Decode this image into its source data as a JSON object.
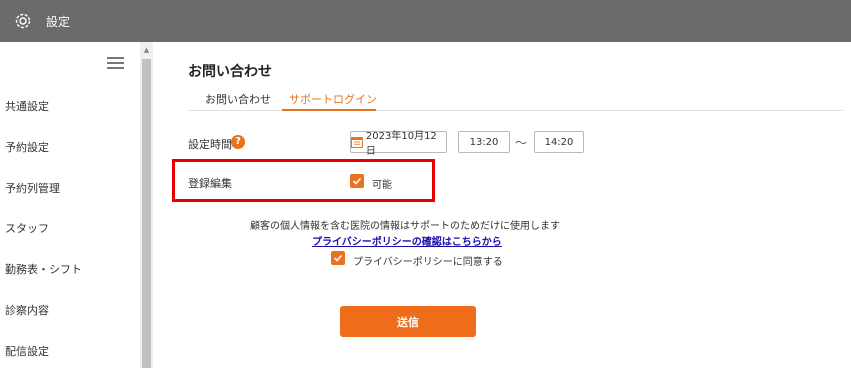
{
  "header": {
    "title": "設定",
    "icon": "gear-icon"
  },
  "sidebar": {
    "menu_icon": "hamburger-menu-icon",
    "items": [
      {
        "label": "共通設定"
      },
      {
        "label": "予約設定"
      },
      {
        "label": "予約列管理"
      },
      {
        "label": "スタッフ"
      },
      {
        "label": "勤務表・シフト"
      },
      {
        "label": "診察内容"
      },
      {
        "label": "配信設定"
      }
    ]
  },
  "main": {
    "title": "お問い合わせ",
    "tabs": [
      {
        "label": "お問い合わせ",
        "active": false
      },
      {
        "label": "サポートログイン",
        "active": true
      }
    ],
    "form": {
      "time_label": "設定時間",
      "help_badge": "?",
      "date": "2023年10月12日",
      "start_time": "13:20",
      "separator": "～",
      "end_time": "14:20",
      "edit_label": "登録編集",
      "edit_checkbox_label": "可能",
      "edit_checked": true
    },
    "notice": "顧客の個人情報を含む医院の情報はサポートのためだけに使用します",
    "privacy_link": "プライバシーポリシーの確認はこちらから",
    "agree_label": "プライバシーポリシーに同意する",
    "agree_checked": true,
    "submit_label": "送信"
  },
  "colors": {
    "accent": "#e8731e",
    "header_bg": "#6b6b6b",
    "highlight": "#e60000",
    "link": "#1a0dab"
  }
}
